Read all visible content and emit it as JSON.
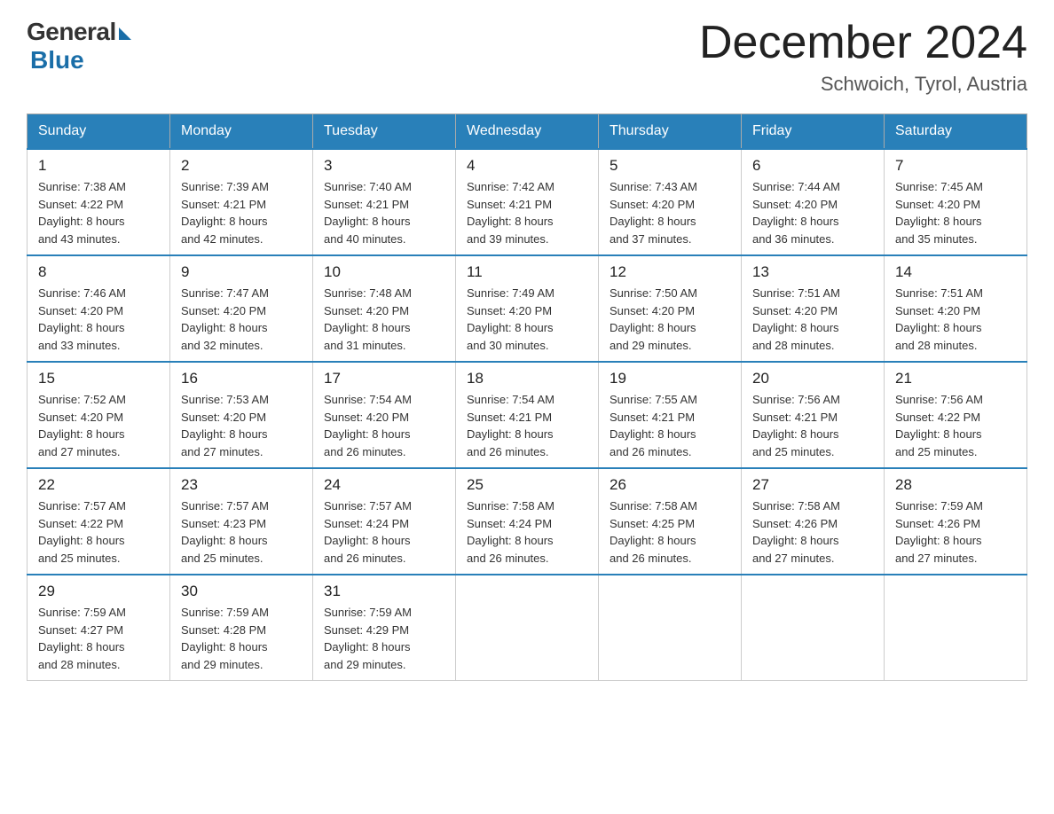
{
  "logo": {
    "general": "General",
    "blue": "Blue"
  },
  "title": "December 2024",
  "location": "Schwoich, Tyrol, Austria",
  "days_of_week": [
    "Sunday",
    "Monday",
    "Tuesday",
    "Wednesday",
    "Thursday",
    "Friday",
    "Saturday"
  ],
  "weeks": [
    [
      {
        "day": "1",
        "sunrise": "7:38 AM",
        "sunset": "4:22 PM",
        "daylight": "8 hours and 43 minutes."
      },
      {
        "day": "2",
        "sunrise": "7:39 AM",
        "sunset": "4:21 PM",
        "daylight": "8 hours and 42 minutes."
      },
      {
        "day": "3",
        "sunrise": "7:40 AM",
        "sunset": "4:21 PM",
        "daylight": "8 hours and 40 minutes."
      },
      {
        "day": "4",
        "sunrise": "7:42 AM",
        "sunset": "4:21 PM",
        "daylight": "8 hours and 39 minutes."
      },
      {
        "day": "5",
        "sunrise": "7:43 AM",
        "sunset": "4:20 PM",
        "daylight": "8 hours and 37 minutes."
      },
      {
        "day": "6",
        "sunrise": "7:44 AM",
        "sunset": "4:20 PM",
        "daylight": "8 hours and 36 minutes."
      },
      {
        "day": "7",
        "sunrise": "7:45 AM",
        "sunset": "4:20 PM",
        "daylight": "8 hours and 35 minutes."
      }
    ],
    [
      {
        "day": "8",
        "sunrise": "7:46 AM",
        "sunset": "4:20 PM",
        "daylight": "8 hours and 33 minutes."
      },
      {
        "day": "9",
        "sunrise": "7:47 AM",
        "sunset": "4:20 PM",
        "daylight": "8 hours and 32 minutes."
      },
      {
        "day": "10",
        "sunrise": "7:48 AM",
        "sunset": "4:20 PM",
        "daylight": "8 hours and 31 minutes."
      },
      {
        "day": "11",
        "sunrise": "7:49 AM",
        "sunset": "4:20 PM",
        "daylight": "8 hours and 30 minutes."
      },
      {
        "day": "12",
        "sunrise": "7:50 AM",
        "sunset": "4:20 PM",
        "daylight": "8 hours and 29 minutes."
      },
      {
        "day": "13",
        "sunrise": "7:51 AM",
        "sunset": "4:20 PM",
        "daylight": "8 hours and 28 minutes."
      },
      {
        "day": "14",
        "sunrise": "7:51 AM",
        "sunset": "4:20 PM",
        "daylight": "8 hours and 28 minutes."
      }
    ],
    [
      {
        "day": "15",
        "sunrise": "7:52 AM",
        "sunset": "4:20 PM",
        "daylight": "8 hours and 27 minutes."
      },
      {
        "day": "16",
        "sunrise": "7:53 AM",
        "sunset": "4:20 PM",
        "daylight": "8 hours and 27 minutes."
      },
      {
        "day": "17",
        "sunrise": "7:54 AM",
        "sunset": "4:20 PM",
        "daylight": "8 hours and 26 minutes."
      },
      {
        "day": "18",
        "sunrise": "7:54 AM",
        "sunset": "4:21 PM",
        "daylight": "8 hours and 26 minutes."
      },
      {
        "day": "19",
        "sunrise": "7:55 AM",
        "sunset": "4:21 PM",
        "daylight": "8 hours and 26 minutes."
      },
      {
        "day": "20",
        "sunrise": "7:56 AM",
        "sunset": "4:21 PM",
        "daylight": "8 hours and 25 minutes."
      },
      {
        "day": "21",
        "sunrise": "7:56 AM",
        "sunset": "4:22 PM",
        "daylight": "8 hours and 25 minutes."
      }
    ],
    [
      {
        "day": "22",
        "sunrise": "7:57 AM",
        "sunset": "4:22 PM",
        "daylight": "8 hours and 25 minutes."
      },
      {
        "day": "23",
        "sunrise": "7:57 AM",
        "sunset": "4:23 PM",
        "daylight": "8 hours and 25 minutes."
      },
      {
        "day": "24",
        "sunrise": "7:57 AM",
        "sunset": "4:24 PM",
        "daylight": "8 hours and 26 minutes."
      },
      {
        "day": "25",
        "sunrise": "7:58 AM",
        "sunset": "4:24 PM",
        "daylight": "8 hours and 26 minutes."
      },
      {
        "day": "26",
        "sunrise": "7:58 AM",
        "sunset": "4:25 PM",
        "daylight": "8 hours and 26 minutes."
      },
      {
        "day": "27",
        "sunrise": "7:58 AM",
        "sunset": "4:26 PM",
        "daylight": "8 hours and 27 minutes."
      },
      {
        "day": "28",
        "sunrise": "7:59 AM",
        "sunset": "4:26 PM",
        "daylight": "8 hours and 27 minutes."
      }
    ],
    [
      {
        "day": "29",
        "sunrise": "7:59 AM",
        "sunset": "4:27 PM",
        "daylight": "8 hours and 28 minutes."
      },
      {
        "day": "30",
        "sunrise": "7:59 AM",
        "sunset": "4:28 PM",
        "daylight": "8 hours and 29 minutes."
      },
      {
        "day": "31",
        "sunrise": "7:59 AM",
        "sunset": "4:29 PM",
        "daylight": "8 hours and 29 minutes."
      },
      null,
      null,
      null,
      null
    ]
  ],
  "labels": {
    "sunrise": "Sunrise:",
    "sunset": "Sunset:",
    "daylight": "Daylight:"
  }
}
